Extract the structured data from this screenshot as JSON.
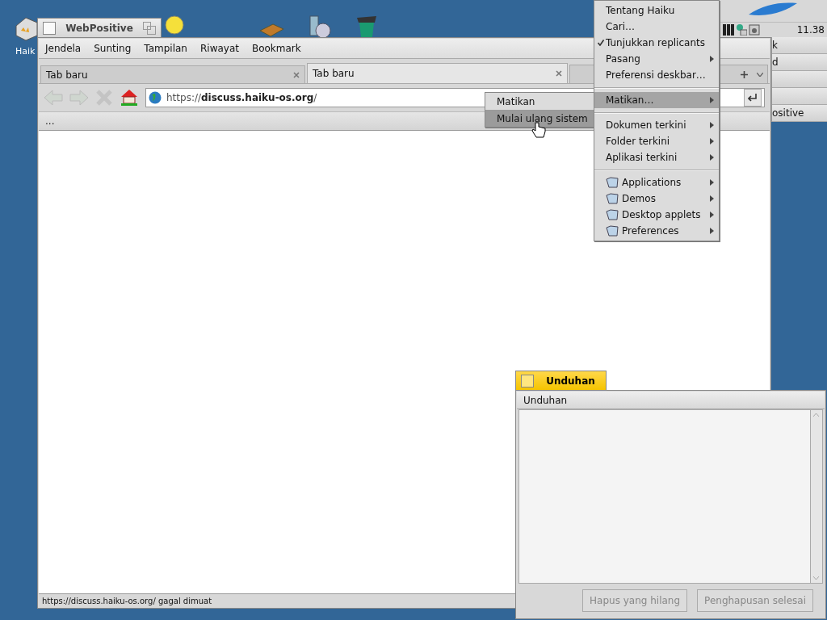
{
  "desktop": {
    "icons": [
      {
        "label": "Haik"
      }
    ]
  },
  "deskbar": {
    "clock": "11.38",
    "app_rows": [
      {
        "kind": "item",
        "label": "k"
      },
      {
        "kind": "item",
        "label": "d"
      },
      {
        "kind": "blank"
      },
      {
        "kind": "blank"
      },
      {
        "kind": "item",
        "label": "ositive"
      }
    ]
  },
  "browser": {
    "title": "WebPositive",
    "active": false,
    "menu": [
      "Jendela",
      "Sunting",
      "Tampilan",
      "Riwayat",
      "Bookmark"
    ],
    "tabs": [
      {
        "label": "Tab baru",
        "selected": false
      },
      {
        "label": "Tab baru",
        "selected": true
      }
    ],
    "url": "https://**discuss.haiku-os.org**/",
    "bookmark_bar": "...",
    "status": "https://discuss.haiku-os.org/ gagal dimuat"
  },
  "deskbar_menu": {
    "items": [
      {
        "kind": "item",
        "label": "Tentang Haiku",
        "checked": false,
        "submenu": false,
        "selected": false
      },
      {
        "kind": "item",
        "label": "Cari…",
        "checked": false,
        "submenu": false,
        "selected": false
      },
      {
        "kind": "item",
        "label": "Tunjukkan replicants",
        "checked": true,
        "submenu": false,
        "selected": false
      },
      {
        "kind": "item",
        "label": "Pasang",
        "checked": false,
        "submenu": true,
        "selected": false
      },
      {
        "kind": "item",
        "label": "Preferensi deskbar…",
        "checked": false,
        "submenu": false,
        "selected": false
      },
      {
        "kind": "separator"
      },
      {
        "kind": "item",
        "label": "Matikan…",
        "checked": false,
        "submenu": true,
        "selected": true
      },
      {
        "kind": "separator"
      },
      {
        "kind": "item",
        "label": "Dokumen terkini",
        "checked": false,
        "submenu": true,
        "selected": false
      },
      {
        "kind": "item",
        "label": "Folder terkini",
        "checked": false,
        "submenu": true,
        "selected": false
      },
      {
        "kind": "item",
        "label": "Aplikasi terkini",
        "checked": false,
        "submenu": true,
        "selected": false
      },
      {
        "kind": "separator"
      },
      {
        "kind": "folder",
        "label": "Applications",
        "checked": false,
        "submenu": true,
        "selected": false
      },
      {
        "kind": "folder",
        "label": "Demos",
        "checked": false,
        "submenu": true,
        "selected": false
      },
      {
        "kind": "folder",
        "label": "Desktop applets",
        "checked": false,
        "submenu": true,
        "selected": false
      },
      {
        "kind": "folder",
        "label": "Preferences",
        "checked": false,
        "submenu": true,
        "selected": false
      }
    ]
  },
  "shutdown_submenu": {
    "items": [
      {
        "label": "Matikan",
        "selected": false
      },
      {
        "label": "Mulai ulang sistem",
        "selected": true
      }
    ]
  },
  "downloads": {
    "title": "Unduhan",
    "active": true,
    "header": "Unduhan",
    "buttons": [
      {
        "label": "Hapus yang hilang",
        "disabled": true
      },
      {
        "label": "Penghapusan selesai",
        "disabled": true
      }
    ]
  }
}
